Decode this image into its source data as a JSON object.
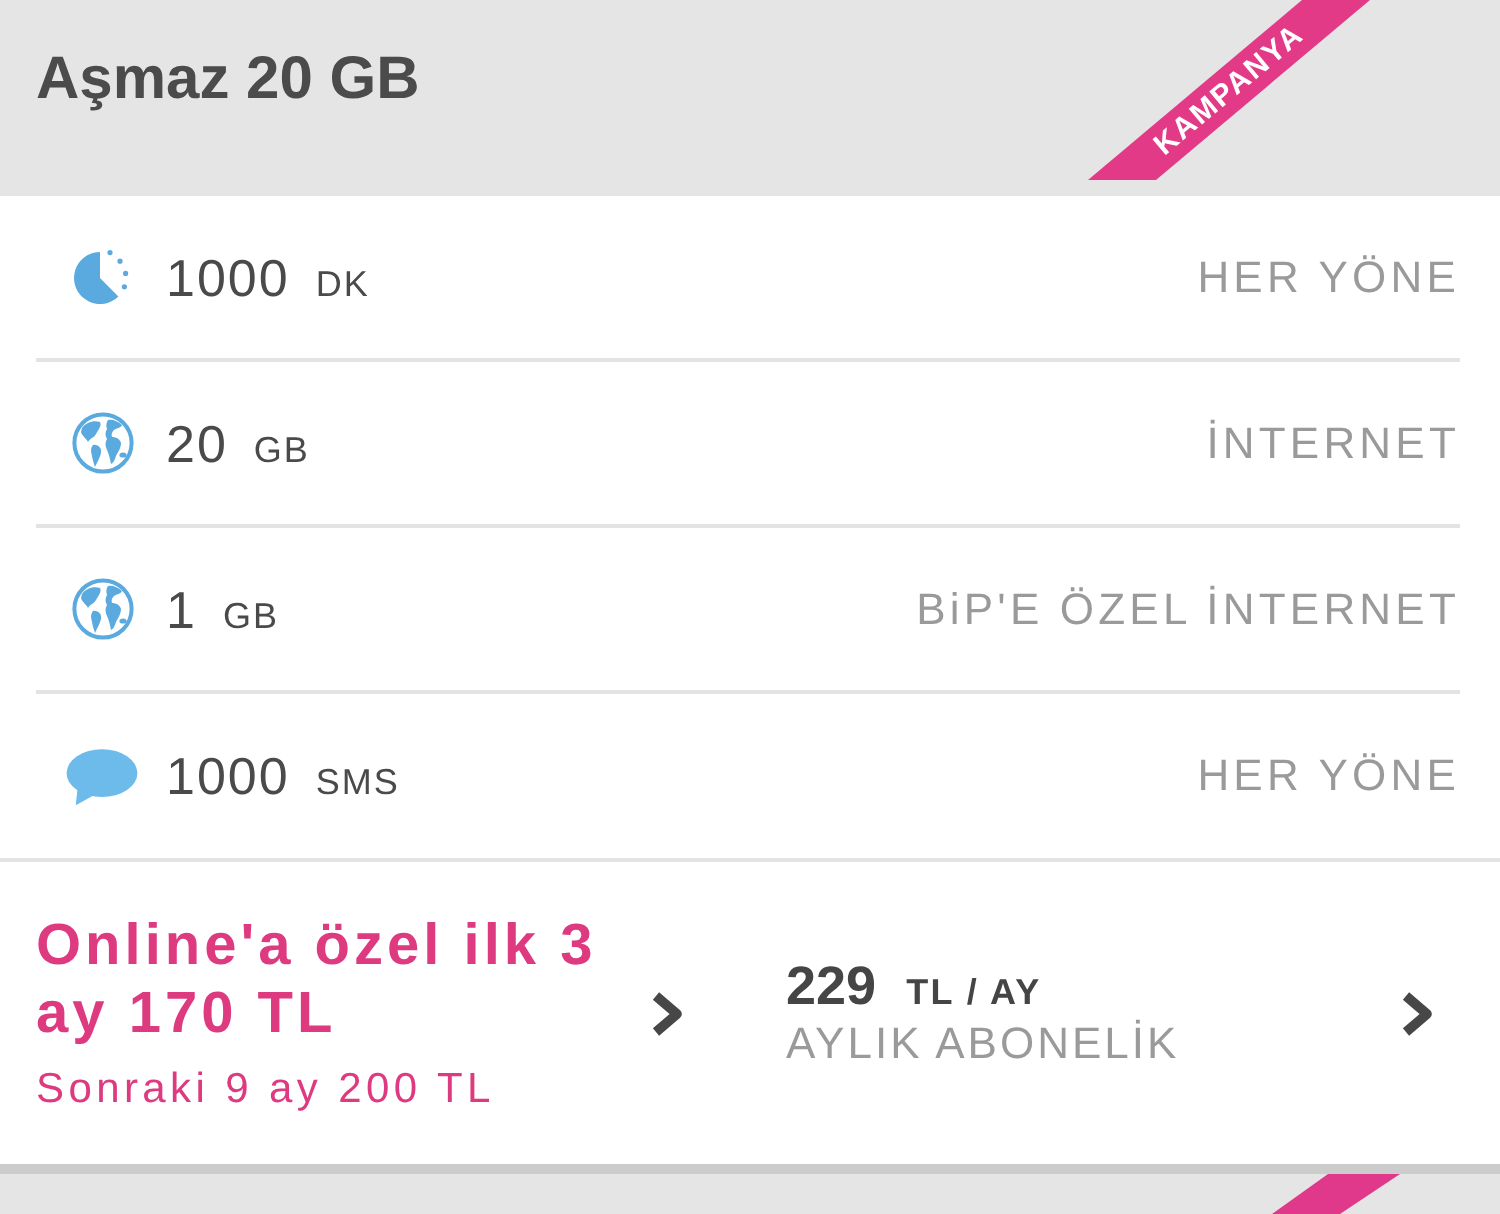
{
  "plan": {
    "title": "Aşmaz 20 GB",
    "ribbon": "KAMPANYA"
  },
  "allowances": [
    {
      "kind": "minutes",
      "amount": "1000",
      "unit": "DK",
      "scope": "HER YÖNE"
    },
    {
      "kind": "data",
      "amount": "20",
      "unit": "GB",
      "scope": "İNTERNET"
    },
    {
      "kind": "data",
      "amount": "1",
      "unit": "GB",
      "scope": "BiP'E ÖZEL İNTERNET"
    },
    {
      "kind": "sms",
      "amount": "1000",
      "unit": "SMS",
      "scope": "HER YÖNE"
    }
  ],
  "pricing": {
    "promo": {
      "headline": "Online'a özel ilk 3 ay 170 TL",
      "note": "Sonraki 9 ay 200 TL"
    },
    "monthly": {
      "amount": "229",
      "unit": "TL / AY",
      "label": "AYLIK ABONELİK"
    }
  },
  "next_plan": {
    "campaign": true
  }
}
